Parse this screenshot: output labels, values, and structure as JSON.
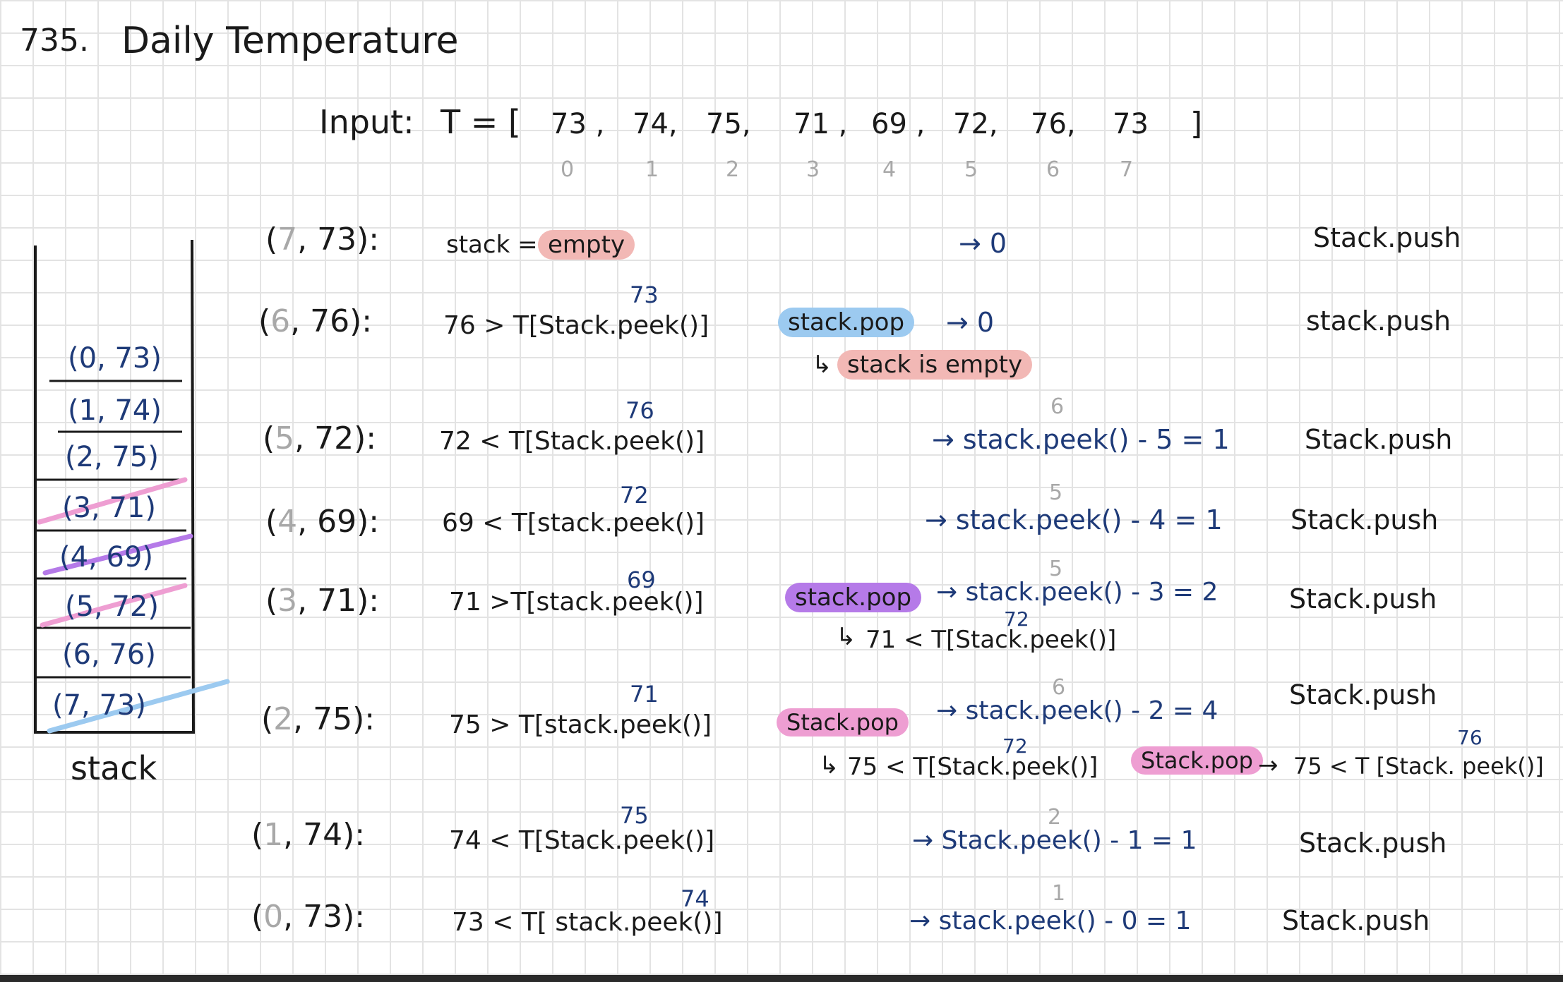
{
  "title": {
    "number": "735.",
    "name": "Daily Temperature"
  },
  "input": {
    "label": "Input:",
    "open": "T = [",
    "values": [
      "73 ,",
      "74,",
      "75,",
      "71 ,",
      "69 ,",
      "72,",
      "76,",
      "73"
    ],
    "close": "]",
    "indices": [
      "0",
      "1",
      "2",
      "3",
      "4",
      "5",
      "6",
      "7"
    ]
  },
  "stack": {
    "label": "stack",
    "items": [
      "(0, 73)",
      "(1, 74)",
      "(2, 75)",
      "(3, 71)",
      "(4, 69)",
      "(5, 72)",
      "(6, 76)",
      "(7, 73)"
    ]
  },
  "colors": {
    "ink": "#1a1a1a",
    "blue_ink": "#1e3a78",
    "gray_ink": "#a8a8a8",
    "highlight_red": "#f2b8b5",
    "highlight_blue": "#9ccaf0",
    "highlight_purple": "#b57ae8",
    "highlight_pink": "#ee9ed2",
    "grid": "#e3e3e3"
  },
  "rows": [
    {
      "open": "(",
      "idx": "7",
      "val": ", 73):",
      "cmp": "stack =",
      "hl": "empty",
      "res": "→ 0",
      "act": "Stack.push"
    },
    {
      "open": "(",
      "idx": "6",
      "val": ", 76):",
      "cmp": "76 > T[Stack.peek()]",
      "sup": "73",
      "hl": "stack.pop",
      "res": "→ 0",
      "sub_hl": "stack is empty",
      "act": "stack.push"
    },
    {
      "open": "(",
      "idx": "5",
      "val": ", 72):",
      "cmp": "72 < T[Stack.peek()]",
      "sup": "76",
      "pre": "6",
      "res": "→ stack.peek() - 5 = 1",
      "act": "Stack.push"
    },
    {
      "open": "(",
      "idx": "4",
      "val": ", 69):",
      "cmp": "69 < T[stack.peek()]",
      "sup": "72",
      "pre": "5",
      "res": "→ stack.peek() - 4 = 1",
      "act": "Stack.push"
    },
    {
      "open": "(",
      "idx": "3",
      "val": ", 71):",
      "cmp": "71 >T[stack.peek()]",
      "sup": "69",
      "hl": "stack.pop",
      "pre": "5",
      "res": "→ stack.peek() - 3 = 2",
      "sub": "71 < T[Stack.peek()]",
      "sub_sup": "72",
      "act": "Stack.push"
    },
    {
      "open": "(",
      "idx": "2",
      "val": ", 75):",
      "cmp": "75 > T[stack.peek()]",
      "sup": "71",
      "hl": "Stack.pop",
      "pre": "6",
      "res": "→ stack.peek() - 2 = 4",
      "sub": "75 < T[Stack.peek()]",
      "sub_sup": "72",
      "sub_hl": "Stack.pop",
      "sub2": "75 < T [Stack. peek()]",
      "sub2_sup": "76",
      "act": "Stack.push"
    },
    {
      "open": "(",
      "idx": "1",
      "val": ", 74):",
      "cmp": "74 < T[Stack.peek()]",
      "sup": "75",
      "pre": "2",
      "res": "→ Stack.peek() - 1 = 1",
      "act": "Stack.push"
    },
    {
      "open": "(",
      "idx": "0",
      "val": ", 73):",
      "cmp": "73 < T[ stack.peek()]",
      "sup": "74",
      "pre": "1",
      "res": "→ stack.peek() - 0 = 1",
      "act": "Stack.push"
    }
  ]
}
